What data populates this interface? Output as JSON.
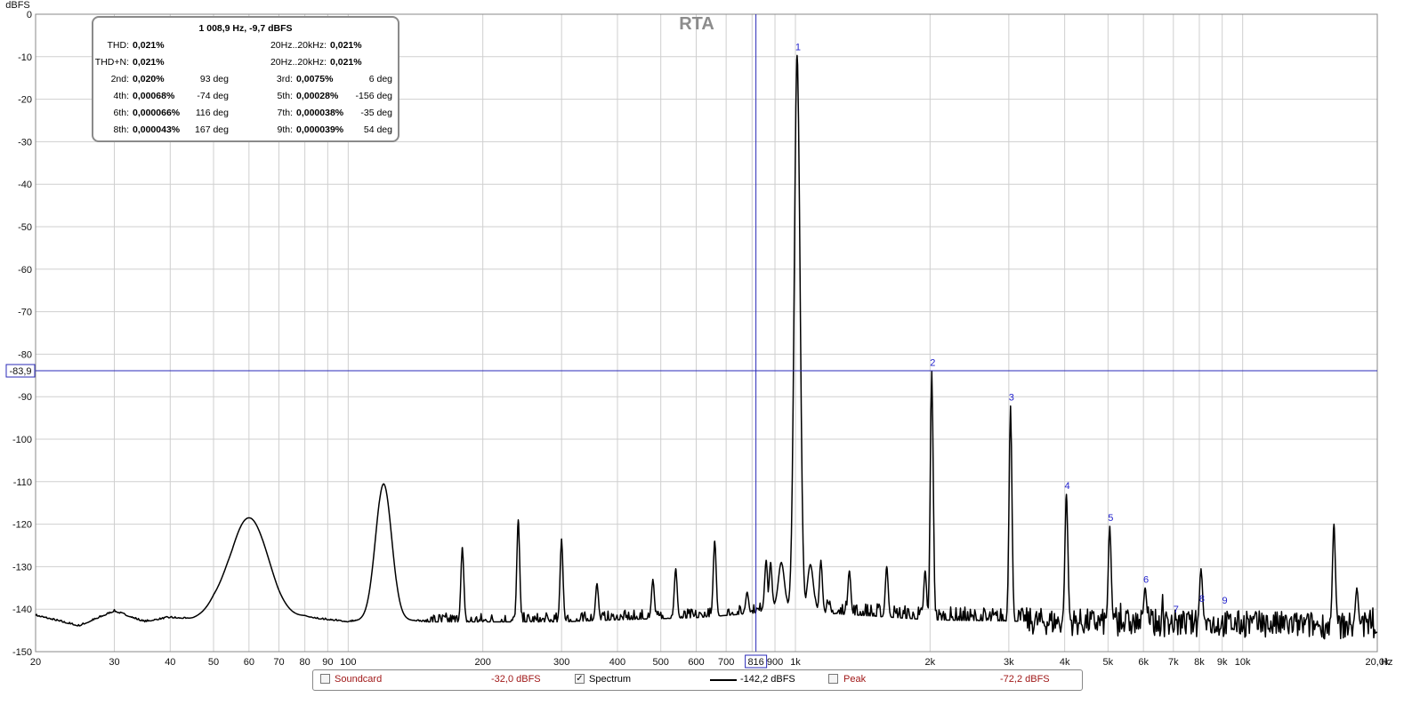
{
  "chart_data": {
    "type": "line",
    "title": "RTA",
    "ylabel": "dBFS",
    "x_unit_label": "Hz",
    "x_scale": "log",
    "xlim": [
      20,
      20000
    ],
    "ylim": [
      -150,
      0
    ],
    "grid": true,
    "y_ticks": [
      "0",
      "-10",
      "-20",
      "-30",
      "-40",
      "-50",
      "-60",
      "-70",
      "-80",
      "-90",
      "-100",
      "-110",
      "-120",
      "-130",
      "-140",
      "-150"
    ],
    "x_ticks": [
      {
        "v": 20,
        "label": "20"
      },
      {
        "v": 30,
        "label": "30"
      },
      {
        "v": 40,
        "label": "40"
      },
      {
        "v": 50,
        "label": "50"
      },
      {
        "v": 60,
        "label": "60"
      },
      {
        "v": 70,
        "label": "70"
      },
      {
        "v": 80,
        "label": "80"
      },
      {
        "v": 90,
        "label": "90"
      },
      {
        "v": 100,
        "label": "100"
      },
      {
        "v": 200,
        "label": "200"
      },
      {
        "v": 300,
        "label": "300"
      },
      {
        "v": 400,
        "label": "400"
      },
      {
        "v": 500,
        "label": "500"
      },
      {
        "v": 600,
        "label": "600"
      },
      {
        "v": 700,
        "label": "700"
      },
      {
        "v": 900,
        "label": "900"
      },
      {
        "v": 1000,
        "label": "1k"
      },
      {
        "v": 2000,
        "label": "2k"
      },
      {
        "v": 3000,
        "label": "3k"
      },
      {
        "v": 4000,
        "label": "4k"
      },
      {
        "v": 5000,
        "label": "5k"
      },
      {
        "v": 6000,
        "label": "6k"
      },
      {
        "v": 7000,
        "label": "7k"
      },
      {
        "v": 8000,
        "label": "8k"
      },
      {
        "v": 9000,
        "label": "9k"
      },
      {
        "v": 10000,
        "label": "10k"
      },
      {
        "v": 20000,
        "label": "20,0k"
      }
    ],
    "cursor": {
      "x": 816,
      "x_label": "816",
      "y": -83.9,
      "y_label": "-83,9"
    },
    "series": [
      {
        "name": "Spectrum",
        "color": "#000000",
        "baseline": [
          [
            20,
            -141.5
          ],
          [
            25,
            -144
          ],
          [
            30,
            -140.5
          ],
          [
            35,
            -143
          ],
          [
            40,
            -142
          ],
          [
            45,
            -142.5
          ],
          [
            50,
            -142
          ],
          [
            55,
            -144
          ],
          [
            70,
            -144
          ],
          [
            80,
            -142
          ],
          [
            100,
            -143
          ],
          [
            120,
            -142
          ],
          [
            150,
            -143
          ],
          [
            200,
            -143
          ],
          [
            300,
            -143
          ],
          [
            400,
            -142.5
          ],
          [
            600,
            -142
          ],
          [
            800,
            -141
          ],
          [
            950,
            -139
          ],
          [
            1200,
            -141
          ],
          [
            2000,
            -142.5
          ],
          [
            4000,
            -143
          ],
          [
            10000,
            -143.5
          ],
          [
            20000,
            -144
          ]
        ],
        "broad_peaks": [
          {
            "f": 60,
            "db": -118.5,
            "w": 0.045
          },
          {
            "f": 120,
            "db": -110.5,
            "w": 0.018
          }
        ],
        "spikes": [
          {
            "f": 180,
            "db": -125.5
          },
          {
            "f": 240,
            "db": -119
          },
          {
            "f": 300,
            "db": -123.5
          },
          {
            "f": 360,
            "db": -134
          },
          {
            "f": 480,
            "db": -133
          },
          {
            "f": 540,
            "db": -130.5
          },
          {
            "f": 660,
            "db": -124
          },
          {
            "f": 780,
            "db": -136
          },
          {
            "f": 860,
            "db": -128.5
          },
          {
            "f": 880,
            "db": -129
          },
          {
            "f": 930,
            "db": -129
          },
          {
            "f": 1008.9,
            "db": -9.7
          },
          {
            "f": 1080,
            "db": -129.5
          },
          {
            "f": 1140,
            "db": -128.5
          },
          {
            "f": 1320,
            "db": -131
          },
          {
            "f": 1600,
            "db": -130
          },
          {
            "f": 1950,
            "db": -131
          },
          {
            "f": 2017.8,
            "db": -84
          },
          {
            "f": 3026.7,
            "db": -92.2
          },
          {
            "f": 4035.6,
            "db": -113
          },
          {
            "f": 5044.5,
            "db": -120.5
          },
          {
            "f": 6053.4,
            "db": -135
          },
          {
            "f": 8071.2,
            "db": -130.5
          },
          {
            "f": 16000,
            "db": -120
          },
          {
            "f": 18000,
            "db": -135
          }
        ]
      }
    ],
    "harmonic_markers": [
      {
        "label": "1",
        "f": 1008.9,
        "db": -9.7
      },
      {
        "label": "2",
        "f": 2017.8,
        "db": -84
      },
      {
        "label": "3",
        "f": 3026.7,
        "db": -92.2
      },
      {
        "label": "4",
        "f": 4035.6,
        "db": -113
      },
      {
        "label": "5",
        "f": 5044.5,
        "db": -120.5
      },
      {
        "label": "6",
        "f": 6053.4,
        "db": -135
      },
      {
        "label": "7",
        "f": 7062.3,
        "db": -142
      },
      {
        "label": "8",
        "f": 8071.2,
        "db": -139.5
      },
      {
        "label": "9",
        "f": 9080.1,
        "db": -140
      }
    ]
  },
  "distortion": {
    "header": "1 008,9 Hz, -9,7 dBFS",
    "thd_label": "THD:",
    "thd": "0,021%",
    "thd_range_label": "20Hz..20kHz:",
    "thd_range": "0,021%",
    "thdn_label": "THD+N:",
    "thdn": "0,021%",
    "thdn_range_label": "20Hz..20kHz:",
    "thdn_range": "0,021%",
    "harmonics": [
      {
        "l1": "2nd:",
        "v1": "0,020%",
        "p1": "93 deg",
        "l2": "3rd:",
        "v2": "0,0075%",
        "p2": "6 deg"
      },
      {
        "l1": "4th:",
        "v1": "0,00068%",
        "p1": "-74 deg",
        "l2": "5th:",
        "v2": "0,00028%",
        "p2": "-156 deg"
      },
      {
        "l1": "6th:",
        "v1": "0,000066%",
        "p1": "116 deg",
        "l2": "7th:",
        "v2": "0,000038%",
        "p2": "-35 deg"
      },
      {
        "l1": "8th:",
        "v1": "0,000043%",
        "p1": "167 deg",
        "l2": "9th:",
        "v2": "0,000039%",
        "p2": "54 deg"
      }
    ]
  },
  "legend": {
    "soundcard_label": "Soundcard",
    "soundcard_value": "-32,0 dBFS",
    "soundcard_checked": false,
    "spectrum_label": "Spectrum",
    "spectrum_value": "-142,2 dBFS",
    "spectrum_checked": true,
    "spectrum_check_mark": "✓",
    "peak_label": "Peak",
    "peak_value": "-72,2 dBFS",
    "peak_checked": false
  }
}
